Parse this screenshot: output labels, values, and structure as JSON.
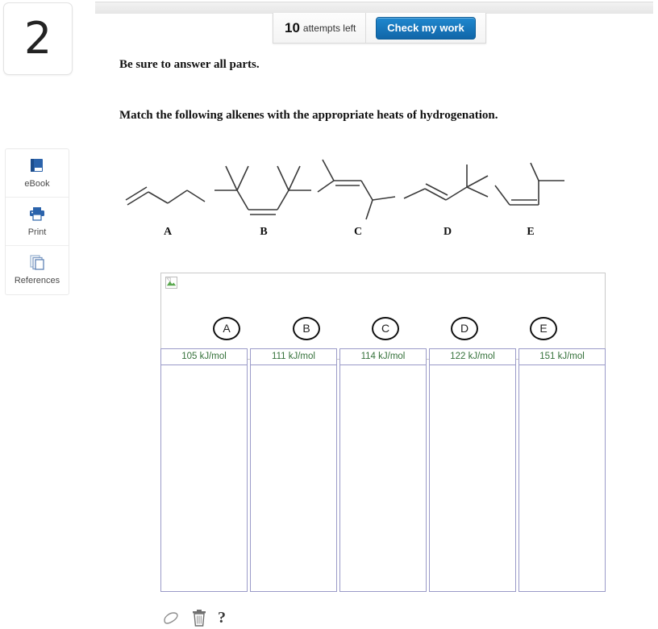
{
  "question": {
    "number": "2",
    "instruction": "Be sure to answer all parts.",
    "prompt": "Match the following alkenes with the appropriate heats of hydrogenation."
  },
  "toolbar": {
    "attempts_count": "10",
    "attempts_label": "attempts left",
    "check_label": "Check my work",
    "check_color": "#1166a8"
  },
  "sidebar": {
    "items": [
      {
        "label": "eBook",
        "icon": "book-icon"
      },
      {
        "label": "Print",
        "icon": "printer-icon"
      },
      {
        "label": "References",
        "icon": "pages-icon"
      }
    ]
  },
  "structures": [
    {
      "label": "A",
      "name": "1-pentene"
    },
    {
      "label": "B",
      "name": "cis-2,2,5,5-tetramethyl-3-hexene"
    },
    {
      "label": "C",
      "name": "2,4-dimethyl-2-pentene"
    },
    {
      "label": "D",
      "name": "trans-4,4-dimethyl-2-pentene"
    },
    {
      "label": "E",
      "name": "cis-4-methyl-2-pentene"
    }
  ],
  "tokens": [
    {
      "label": "A"
    },
    {
      "label": "B"
    },
    {
      "label": "C"
    },
    {
      "label": "D"
    },
    {
      "label": "E"
    }
  ],
  "columns": [
    {
      "header": "105 kJ/mol",
      "value": ""
    },
    {
      "header": "111 kJ/mol",
      "value": ""
    },
    {
      "header": "114 kJ/mol",
      "value": ""
    },
    {
      "header": "122 kJ/mol",
      "value": ""
    },
    {
      "header": "151 kJ/mol",
      "value": ""
    }
  ],
  "column_header_color": "#35713a",
  "bottom_tools": [
    {
      "icon": "eraser-icon"
    },
    {
      "icon": "trash-icon"
    },
    {
      "icon": "help-icon",
      "label": "?"
    }
  ]
}
